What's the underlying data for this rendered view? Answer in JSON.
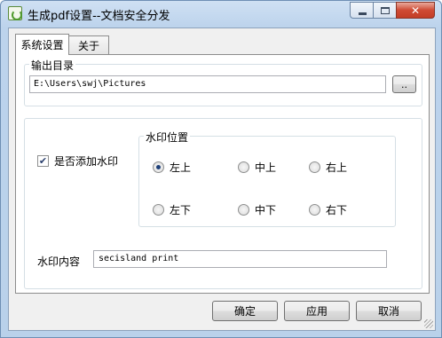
{
  "window": {
    "title": "生成pdf设置--文档安全分发",
    "close_glyph": "✕"
  },
  "tabs": [
    {
      "label": "系统设置",
      "selected": true
    },
    {
      "label": "关于",
      "selected": false
    }
  ],
  "output": {
    "group_label": "输出目录",
    "path": "E:\\Users\\swj\\Pictures",
    "browse_label": ".."
  },
  "watermark": {
    "enable_label": "是否添加水印",
    "enabled": true,
    "check_glyph": "✔",
    "position_label": "水印位置",
    "positions": [
      {
        "label": "左上",
        "selected": true
      },
      {
        "label": "中上",
        "selected": false
      },
      {
        "label": "右上",
        "selected": false
      },
      {
        "label": "左下",
        "selected": false
      },
      {
        "label": "中下",
        "selected": false
      },
      {
        "label": "右下",
        "selected": false
      }
    ],
    "content_label": "水印内容",
    "content_value": "secisland print"
  },
  "buttons": {
    "ok": "确定",
    "apply": "应用",
    "cancel": "取消"
  },
  "colors": {
    "frame": "#b9d1ea",
    "close_button": "#c33d26",
    "panel": "#ffffff",
    "dialog_bg": "#f0f0f0"
  }
}
